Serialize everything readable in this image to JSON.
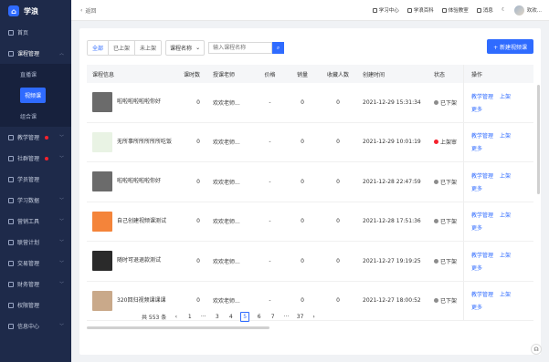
{
  "app": {
    "name": "学浪"
  },
  "sidebar": {
    "items": [
      {
        "label": "首页"
      },
      {
        "label": "课程管理"
      },
      {
        "label": "教学管理"
      },
      {
        "label": "社群管理"
      },
      {
        "label": "学员管理"
      },
      {
        "label": "学习数据"
      },
      {
        "label": "营销工具"
      },
      {
        "label": "联营计划"
      },
      {
        "label": "交易管理"
      },
      {
        "label": "财务管理"
      },
      {
        "label": "权限管理"
      },
      {
        "label": "信息中心"
      }
    ],
    "sub_items": [
      {
        "label": "直播课"
      },
      {
        "label": "视频课"
      },
      {
        "label": "组合课"
      }
    ]
  },
  "topbar": {
    "back_label": "返回",
    "links": [
      {
        "label": "学习中心"
      },
      {
        "label": "学浪百科"
      },
      {
        "label": "体验教室"
      },
      {
        "label": "消息"
      }
    ],
    "user_name": "欢欢..."
  },
  "filters": {
    "tabs": [
      "全部",
      "已上架",
      "未上架"
    ],
    "select_label": "课程名称",
    "search_placeholder": "输入课程名称"
  },
  "actions": {
    "new_button": "+ 新建视频课"
  },
  "table": {
    "headers": {
      "info": "课程信息",
      "count": "课时数",
      "teacher": "授课老师",
      "price": "价格",
      "sales": "销量",
      "fav": "收藏人数",
      "time": "创建时间",
      "status": "状态",
      "ops": "操作"
    },
    "rows": [
      {
        "title": "啦啦啦啦啦啦你好",
        "count": "0",
        "teacher": "欢欢老师...",
        "price": "-",
        "sales": "0",
        "fav": "0",
        "time": "2021-12-29 15:31:34",
        "status": "已下架",
        "status_color": "#8c8c8c",
        "thumb": "#6b6b6b"
      },
      {
        "title": "无所事所所所所所吃饭",
        "count": "0",
        "teacher": "欢欢老师...",
        "price": "-",
        "sales": "0",
        "fav": "0",
        "time": "2021-12-29 10:01:19",
        "status": "上架审",
        "status_color": "#f5222d",
        "thumb": "#e9f3e4"
      },
      {
        "title": "啦啦啦啦啦啦你好",
        "count": "0",
        "teacher": "欢欢老师...",
        "price": "-",
        "sales": "0",
        "fav": "0",
        "time": "2021-12-28 22:47:59",
        "status": "已下架",
        "status_color": "#8c8c8c",
        "thumb": "#6b6b6b"
      },
      {
        "title": "自己创建视频课测试",
        "count": "0",
        "teacher": "欢欢老师...",
        "price": "-",
        "sales": "0",
        "fav": "0",
        "time": "2021-12-28 17:51:36",
        "status": "已下架",
        "status_color": "#8c8c8c",
        "thumb": "#f4843a"
      },
      {
        "title": "随时可退退款测试",
        "count": "0",
        "teacher": "欢欢老师...",
        "price": "-",
        "sales": "0",
        "fav": "0",
        "time": "2021-12-27 19:19:25",
        "status": "已下架",
        "status_color": "#8c8c8c",
        "thumb": "#2a2a2a"
      },
      {
        "title": "320回归视频课课课",
        "count": "0",
        "teacher": "欢欢老师...",
        "price": "-",
        "sales": "0",
        "fav": "0",
        "time": "2021-12-27 18:00:52",
        "status": "已下架",
        "status_color": "#8c8c8c",
        "thumb": "#c9a98a"
      }
    ],
    "ops": {
      "manage": "教学管理",
      "publish": "上架",
      "more": "更多"
    }
  },
  "pagination": {
    "total": "共 553 条",
    "pages": [
      "1",
      "···",
      "3",
      "4",
      "5",
      "6",
      "7",
      "···",
      "37"
    ],
    "current": "5"
  }
}
